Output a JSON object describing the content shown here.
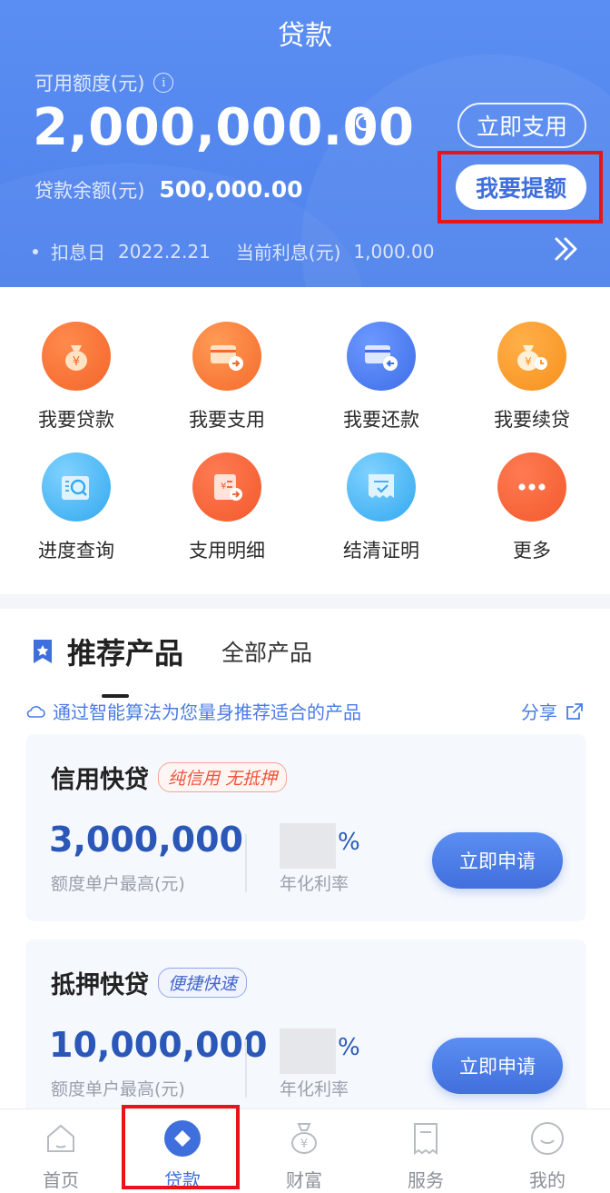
{
  "header": {
    "title": "贷款",
    "quota_label": "可用额度(元)",
    "info_symbol": "i",
    "quota_value": "2,000,000.00",
    "use_button": "立即支用",
    "raise_button": "我要提额",
    "balance_label": "贷款余额(元)",
    "balance_value": "500,000.00",
    "interest_day_label": "扣息日",
    "interest_day_value": "2022.2.21",
    "current_interest_label": "当前利息(元)",
    "current_interest_value": "1,000.00"
  },
  "menu": {
    "items": [
      {
        "label": "我要贷款",
        "icon": "money-bag-icon"
      },
      {
        "label": "我要支用",
        "icon": "card-out-icon"
      },
      {
        "label": "我要还款",
        "icon": "card-return-icon"
      },
      {
        "label": "我要续贷",
        "icon": "money-bag-clock-icon"
      },
      {
        "label": "进度查询",
        "icon": "progress-search-icon"
      },
      {
        "label": "支用明细",
        "icon": "usage-detail-icon"
      },
      {
        "label": "结清证明",
        "icon": "settlement-certificate-icon"
      },
      {
        "label": "更多",
        "icon": "more-icon"
      }
    ]
  },
  "products": {
    "tab_active": "推荐产品",
    "tab_other": "全部产品",
    "tip": "通过智能算法为您量身推荐适合的产品",
    "share": "分享",
    "cards": [
      {
        "name": "信用快贷",
        "tag": "纯信用 无抵押",
        "amount": "3,000,000",
        "amount_label": "额度单户最高(元)",
        "rate_unit": "%",
        "rate_label": "年化利率",
        "apply": "立即申请"
      },
      {
        "name": "抵押快贷",
        "tag": "便捷快速",
        "amount": "10,000,000",
        "amount_label": "额度单户最高(元)",
        "rate_unit": "%",
        "rate_label": "年化利率",
        "apply": "立即申请"
      }
    ]
  },
  "nav": {
    "items": [
      {
        "label": "首页",
        "icon": "home-icon"
      },
      {
        "label": "贷款",
        "icon": "loan-icon"
      },
      {
        "label": "财富",
        "icon": "wealth-icon"
      },
      {
        "label": "服务",
        "icon": "service-icon"
      },
      {
        "label": "我的",
        "icon": "profile-icon"
      }
    ],
    "active_index": 1
  },
  "colors": {
    "brand_blue": "#4f82ec",
    "highlight_red": "#e8141b",
    "amount_blue": "#2a57b8"
  }
}
